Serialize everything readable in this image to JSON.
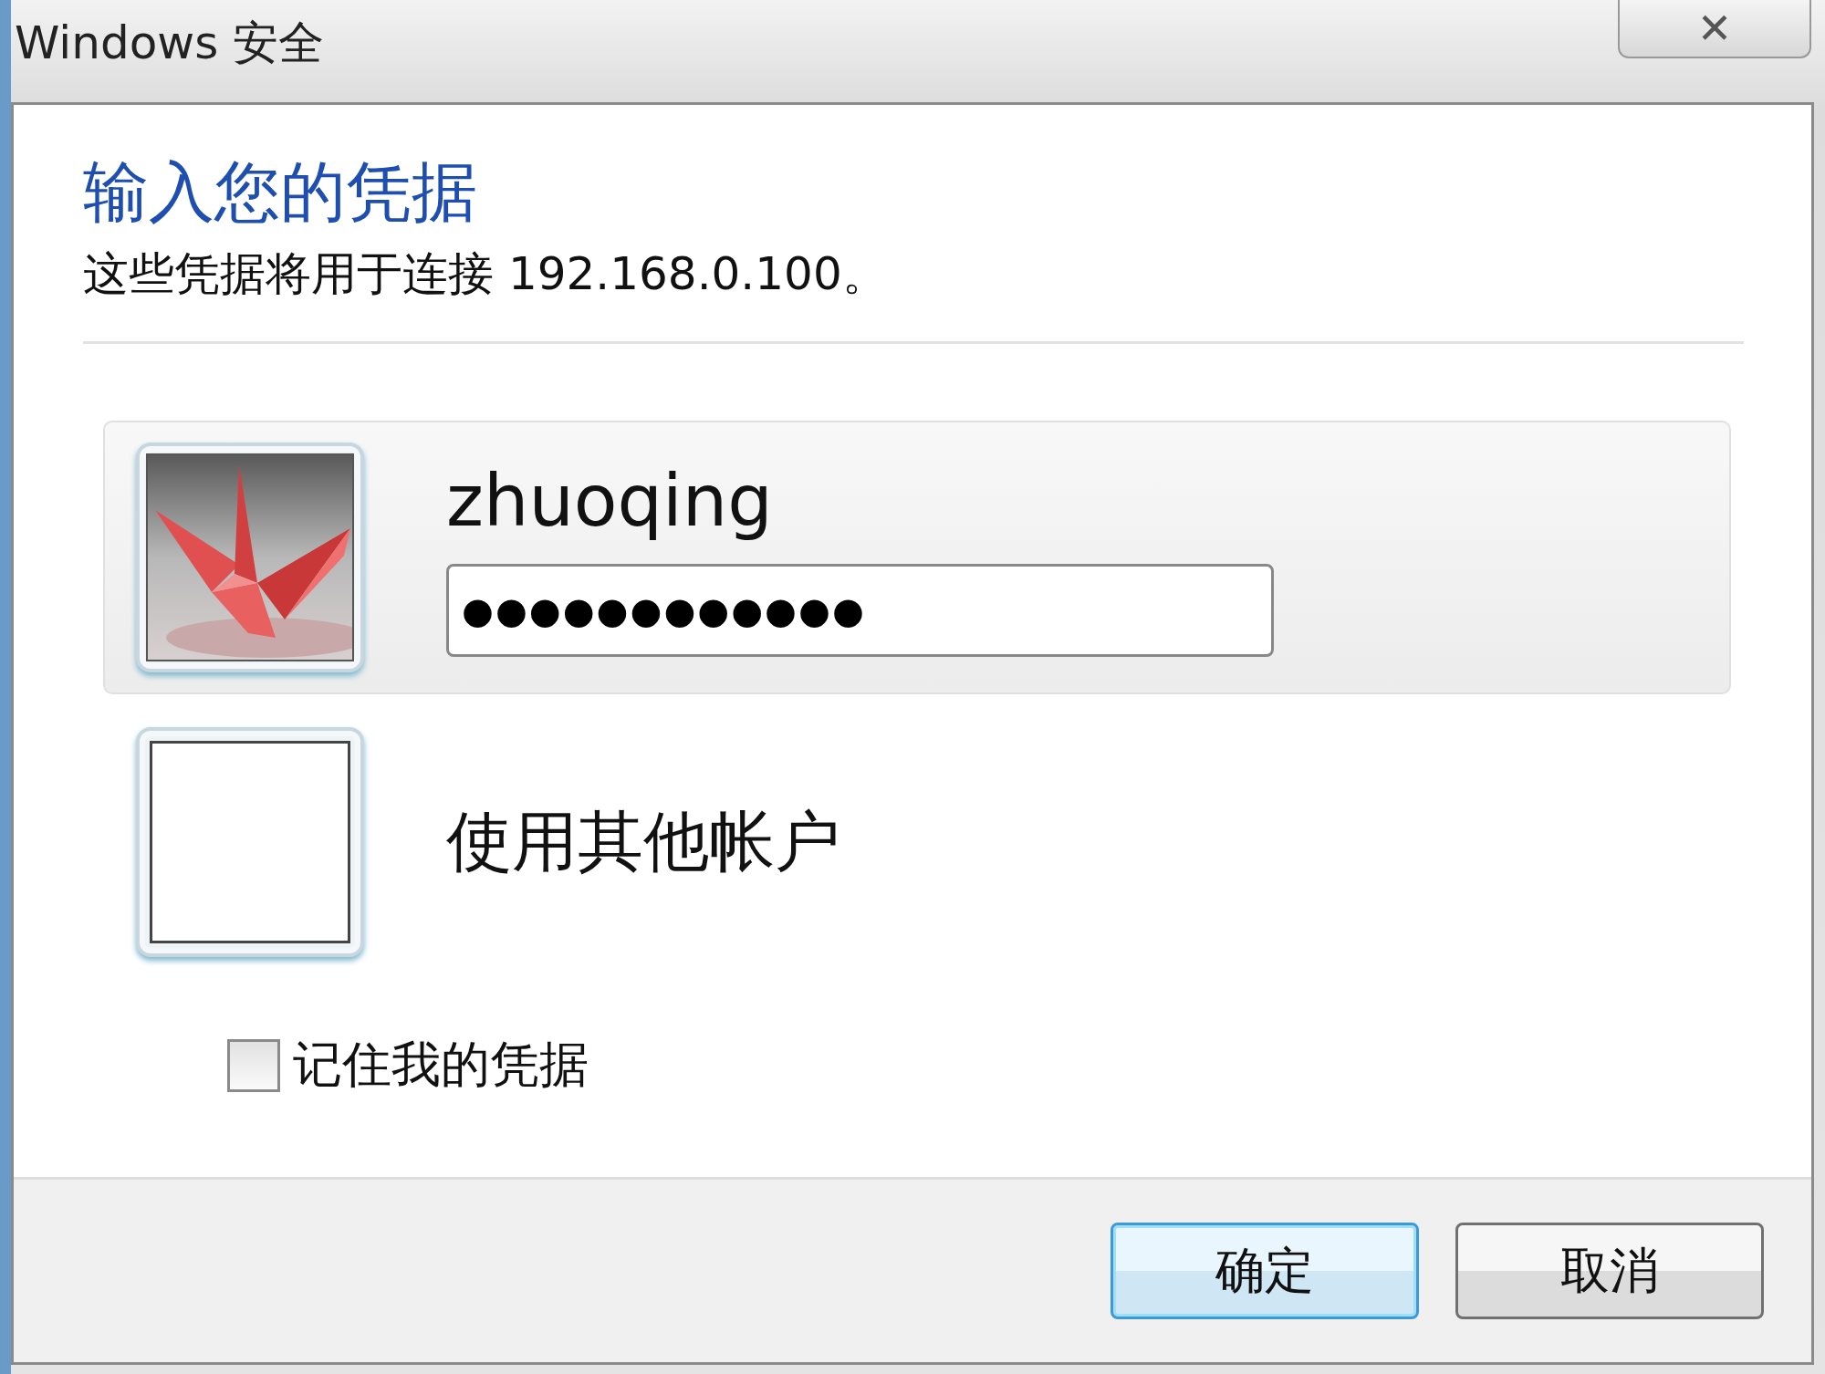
{
  "window": {
    "title": "Windows 安全",
    "close": "✕"
  },
  "heading": "输入您的凭据",
  "subtitle": "这些凭据将用于连接 192.168.0.100。",
  "accounts": [
    {
      "kind": "user",
      "name": "zhuoqing",
      "password": "●●●●●●●●●●●●",
      "selected": true
    },
    {
      "kind": "other",
      "name": "使用其他帐户",
      "selected": false
    }
  ],
  "remember": {
    "label": "记住我的凭据",
    "checked": false
  },
  "buttons": [
    {
      "label": "确定",
      "default": true
    },
    {
      "label": "取消",
      "default": false
    }
  ]
}
